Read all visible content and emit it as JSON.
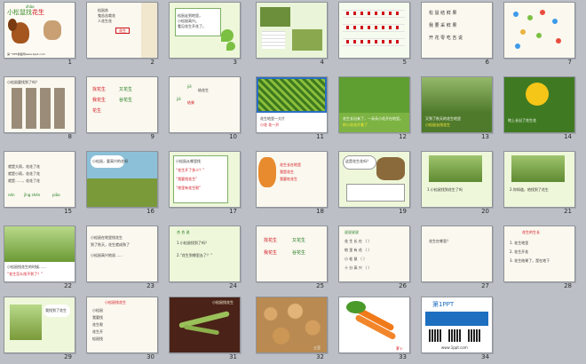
{
  "slides": [
    {
      "num": "1",
      "title_pinyin": "zhǎo",
      "title": "小松鼠找",
      "title_tail": "花生",
      "footer": "第一PPT模板网www.1ppt.com"
    },
    {
      "num": "2",
      "lines": [
        "松鼠苏",
        "鬼苦苦栽花",
        "人花生花"
      ],
      "box": "花生"
    },
    {
      "num": "3",
      "lines": [
        "松鼠走到地里，",
        "小松鼠高兴。",
        "看见花生开花了。"
      ]
    },
    {
      "num": "4"
    },
    {
      "num": "5"
    },
    {
      "num": "6",
      "rows": [
        "松 鼠 结 鲜 果",
        "我 要 采 鲜 果",
        "开 花 零 吃 吉 说"
      ]
    },
    {
      "num": "7"
    },
    {
      "num": "8",
      "title": "小松鼠要找到了吗？"
    },
    {
      "num": "9",
      "rows": [
        "找花生",
        "又花生",
        "我花生",
        "谷花生",
        "花生"
      ]
    },
    {
      "num": "10",
      "lines": [
        "jiē",
        "结花生",
        "jiē",
        "结果"
      ]
    },
    {
      "num": "11",
      "caption": "花生地里一大片",
      "caption2": "小花   花一开"
    },
    {
      "num": "12",
      "caption": "花生长出来了，一朵朵小花开在地里。",
      "caption2": "的小花花开着了"
    },
    {
      "num": "13",
      "caption": "又到了秋天的花生地里",
      "caption2": "小松鼠去找花生"
    },
    {
      "num": "14",
      "caption": "地上长出了花生花"
    },
    {
      "num": "15",
      "lines": [
        "就是大雨，花花了花",
        "就是小雨，花花了花",
        "就是……，花花了花"
      ],
      "bottom": [
        "nén",
        "jīng shén",
        "piāo"
      ]
    },
    {
      "num": "16",
      "bubble": "小松鼠，要高兴的花呀"
    },
    {
      "num": "17",
      "lines": [
        "小松鼠从哪里找",
        "“花生开了多少？”",
        "“我要找花生”",
        "“地里有花生呢”"
      ]
    },
    {
      "num": "18",
      "lines": [
        "花生长在地里",
        "我是花生",
        "我要吃花生"
      ]
    },
    {
      "num": "19",
      "bubble": "这是花生花吗？"
    },
    {
      "num": "20",
      "caption": "1.小松鼠找到花生了吗"
    },
    {
      "num": "21",
      "caption": "2.你知道，他找到了花生"
    },
    {
      "num": "22",
      "caption": "小松鼠找花生的时候……",
      "caption2": "“花生怎么找不到了？”"
    },
    {
      "num": "23",
      "lines": [
        "小松鼠在地里找花生",
        "到了秋天，花生就成熟了",
        "小松鼠高兴地说……"
      ]
    },
    {
      "num": "24",
      "title": "合 合 说",
      "lines": [
        "1.小松鼠找到了吗？",
        "2.“花生到哪里去了？”"
      ]
    },
    {
      "num": "25",
      "rows": [
        "找花生",
        "又花生",
        "我花生",
        "谷花生"
      ]
    },
    {
      "num": "26",
      "title": "说说说说",
      "rows": [
        "花 生 长 在 （ ）",
        "地 里 有 花 （ ）",
        "小 松 鼠 （ ）",
        "十 分 高 兴 （ ）"
      ]
    },
    {
      "num": "27",
      "lines": [
        "花生在哪里？"
      ]
    },
    {
      "num": "28",
      "title": "花生的生长",
      "lines": [
        "1. 花生地里",
        "2. 花生开花",
        "3. 花生结果了，是在地下"
      ]
    },
    {
      "num": "29",
      "bubble": "我找到了花生"
    },
    {
      "num": "30",
      "title": "小松鼠找花生",
      "lines": [
        "小松鼠",
        "我要找",
        "花生呢",
        "花生开",
        "松鼠找"
      ]
    },
    {
      "num": "31",
      "label": "小松鼠找花生"
    },
    {
      "num": "32",
      "label": "土豆"
    },
    {
      "num": "33",
      "label": "萝卜"
    },
    {
      "num": "34",
      "brand": "第1PPT",
      "brand_sub": "www.1ppt.com"
    }
  ],
  "colors": {
    "grid_bg": "#bcc0c6",
    "slide_border": "#8e939a",
    "accent_red": "#d0101a",
    "accent_green": "#7bc043"
  }
}
